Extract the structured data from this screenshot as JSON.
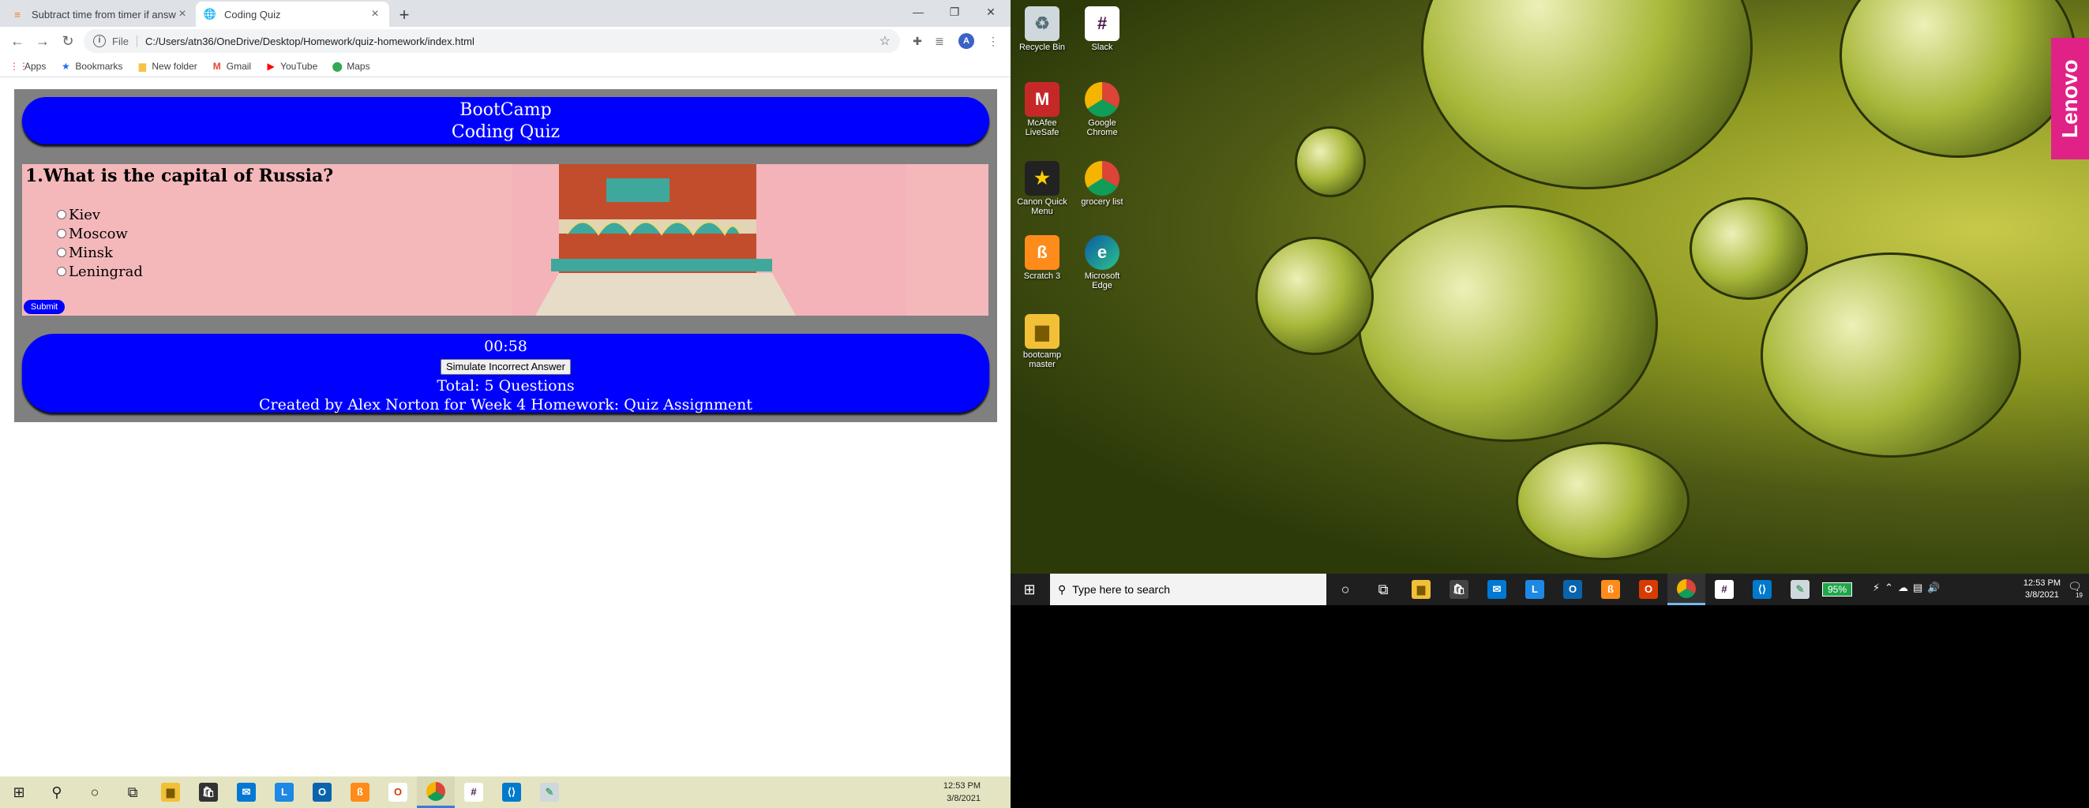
{
  "browser": {
    "tabs": [
      {
        "title": "Subtract time from timer if answ...",
        "active": false
      },
      {
        "title": "Coding Quiz",
        "active": true
      }
    ],
    "url_protocol": "File",
    "url": "C:/Users/atn36/OneDrive/Desktop/Homework/quiz-homework/index.html",
    "avatar_letter": "A",
    "bookmarks": [
      {
        "label": "Apps",
        "icon": "apps-grid-icon"
      },
      {
        "label": "Bookmarks",
        "icon": "star-icon"
      },
      {
        "label": "New folder",
        "icon": "folder-icon"
      },
      {
        "label": "Gmail",
        "icon": "gmail-icon"
      },
      {
        "label": "YouTube",
        "icon": "youtube-icon"
      },
      {
        "label": "Maps",
        "icon": "maps-pin-icon"
      }
    ]
  },
  "quiz": {
    "header_line1": "BootCamp",
    "header_line2": "Coding Quiz",
    "question": "1.What is the capital of Russia?",
    "answers": [
      "Kiev",
      "Moscow",
      "Minsk",
      "Leningrad"
    ],
    "submit_label": "Submit",
    "timer": "00:58",
    "simulate_label": "Simulate Incorrect Answer",
    "total": "Total: 5 Questions",
    "credits": "Created by Alex Norton for Week 4 Homework: Quiz Assignment",
    "colors": {
      "pill": "#0000ff",
      "panel": "#808080",
      "question_bg": "#f4b8bb"
    }
  },
  "left_taskbar": {
    "time": "12:53 PM",
    "date": "3/8/2021"
  },
  "desktop": {
    "brand": "Lenovo",
    "icons": [
      {
        "label": "Recycle Bin",
        "icon": "recycle-bin-icon"
      },
      {
        "label": "Slack",
        "icon": "slack-icon"
      },
      {
        "label": "McAfee LiveSafe",
        "icon": "mcafee-icon"
      },
      {
        "label": "Google Chrome",
        "icon": "chrome-icon"
      },
      {
        "label": "Canon Quick Menu",
        "icon": "canon-icon"
      },
      {
        "label": "grocery list",
        "icon": "chrome-icon"
      },
      {
        "label": "Scratch 3",
        "icon": "scratch-icon"
      },
      {
        "label": "Microsoft Edge",
        "icon": "edge-icon"
      },
      {
        "label": "bootcamp master",
        "icon": "folder-icon"
      }
    ],
    "search_placeholder": "Type here to search",
    "battery": "95%",
    "time": "12:53 PM",
    "date": "3/8/2021",
    "notification_count": "19"
  }
}
